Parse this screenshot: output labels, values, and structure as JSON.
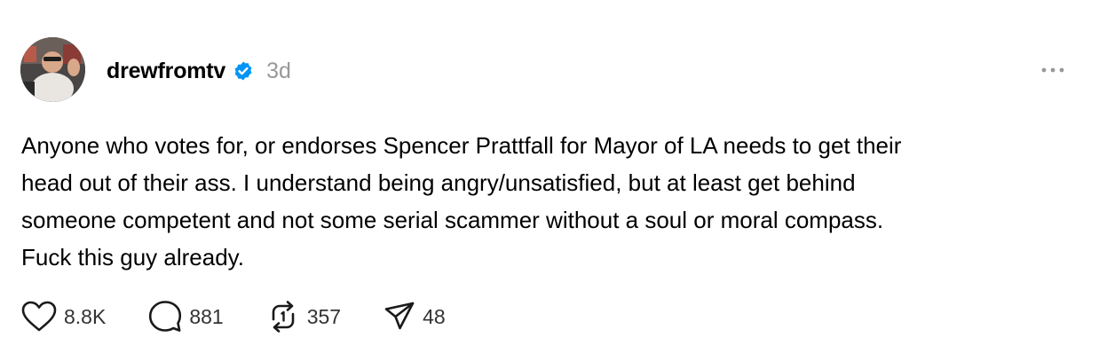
{
  "post": {
    "username": "drewfromtv",
    "time": "3d",
    "body_lines": [
      "Anyone who votes for, or endorses Spencer Prattfall for Mayor of LA needs to get their",
      "head out of their ass. I understand being angry/unsatisfied, but at least get behind",
      "someone competent and not some serial scammer without a soul or moral compass.",
      "Fuck this guy already."
    ],
    "stats": {
      "likes": "8.8K",
      "replies": "881",
      "reposts": "357",
      "shares": "48"
    }
  },
  "colors": {
    "verified": "#0095F6",
    "muted": "#999999",
    "icon": "#1a1a1a"
  },
  "icons": [
    "verified-badge-icon",
    "more-icon",
    "heart-icon",
    "comment-icon",
    "repost-icon",
    "share-icon"
  ]
}
